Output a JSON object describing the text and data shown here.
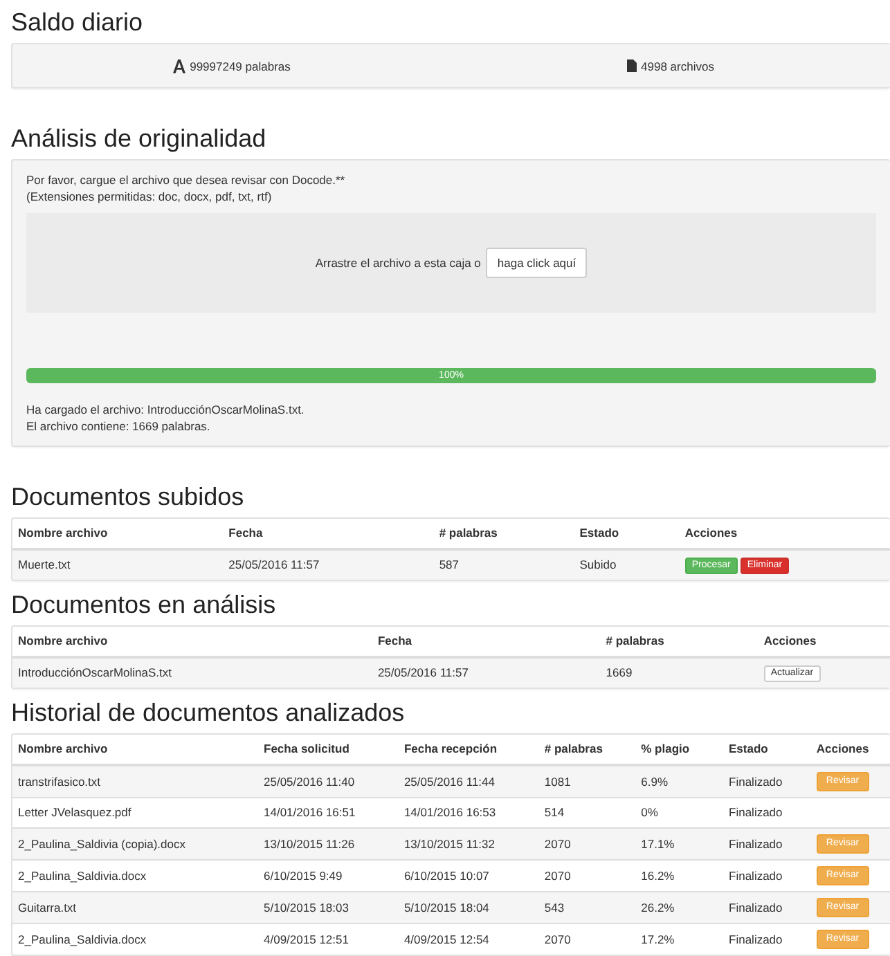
{
  "balance": {
    "title": "Saldo diario",
    "words": "99997249 palabras",
    "files": "4998 archivos"
  },
  "analysis": {
    "title": "Análisis de originalidad",
    "instructions": "Por favor, cargue el archivo que desea revisar con Docode.**",
    "extensions": "(Extensiones permitidas: doc, docx, pdf, txt, rtf)",
    "drop_text": "Arrastre el archivo a esta caja o",
    "drop_button": "haga click aquí",
    "progress": {
      "level": 1,
      "label": "100%"
    },
    "loaded": "Ha cargado el archivo: IntroducciónOscarMolinaS.txt.",
    "contains": "El archivo contiene: 1669 palabras."
  },
  "tables": [
    {
      "title": "Documentos subidos",
      "columns": [
        "Nombre archivo",
        "Fecha",
        "# palabras",
        "Estado",
        "Acciones"
      ],
      "rows": [
        {
          "cells": [
            "Muerte.txt",
            "25/05/2016 11:57",
            "587",
            "Subido"
          ],
          "actions": [
            {
              "kind": "success",
              "label": "Procesar"
            },
            {
              "kind": "danger",
              "label": "Eliminar"
            }
          ]
        }
      ]
    },
    {
      "title": "Documentos en análisis",
      "columns": [
        "Nombre archivo",
        "Fecha",
        "# palabras",
        "Acciones"
      ],
      "rows": [
        {
          "cells": [
            "IntroducciónOscarMolinaS.txt",
            "25/05/2016 11:57",
            "1669"
          ],
          "actions": [
            {
              "kind": "default",
              "label": "Actualizar"
            }
          ]
        }
      ]
    },
    {
      "title": "Historial de documentos analizados",
      "columns": [
        "Nombre archivo",
        "Fecha solicitud",
        "Fecha recepción",
        "# palabras",
        "% plagio",
        "Estado",
        "Acciones"
      ],
      "rows": [
        {
          "cells": [
            "transtrifasico.txt",
            "25/05/2016 11:40",
            "25/05/2016 11:44",
            "1081",
            "6.9%",
            "Finalizado"
          ],
          "actions": [
            {
              "kind": "warning",
              "label": "Revisar"
            }
          ]
        },
        {
          "cells": [
            "Letter JVelasquez.pdf",
            "14/01/2016 16:51",
            "14/01/2016 16:53",
            "514",
            "0%",
            "Finalizado"
          ],
          "actions": []
        },
        {
          "cells": [
            "2_Paulina_Saldivia (copia).docx",
            "13/10/2015 11:26",
            "13/10/2015 11:32",
            "2070",
            "17.1%",
            "Finalizado"
          ],
          "actions": [
            {
              "kind": "warning",
              "label": "Revisar"
            }
          ]
        },
        {
          "cells": [
            "2_Paulina_Saldivia.docx",
            "6/10/2015 9:49",
            "6/10/2015 10:07",
            "2070",
            "16.2%",
            "Finalizado"
          ],
          "actions": [
            {
              "kind": "warning",
              "label": "Revisar"
            }
          ]
        },
        {
          "cells": [
            "Guitarra.txt",
            "5/10/2015 18:03",
            "5/10/2015 18:04",
            "543",
            "26.2%",
            "Finalizado"
          ],
          "actions": [
            {
              "kind": "warning",
              "label": "Revisar"
            }
          ]
        },
        {
          "cells": [
            "2_Paulina_Saldivia.docx",
            "4/09/2015 12:51",
            "4/09/2015 12:54",
            "2070",
            "17.2%",
            "Finalizado"
          ],
          "actions": [
            {
              "kind": "warning",
              "label": "Revisar"
            }
          ]
        }
      ]
    }
  ]
}
